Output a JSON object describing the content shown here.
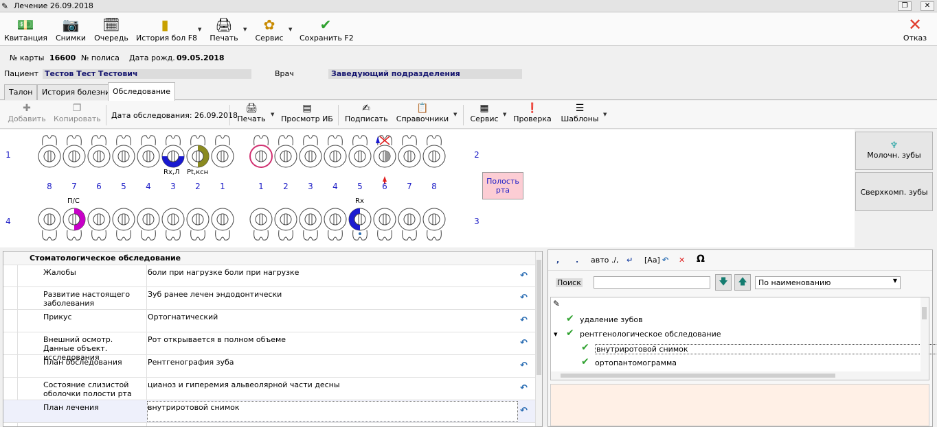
{
  "window": {
    "title": "Лечение 26.09.2018"
  },
  "toolbar": {
    "kvit": "Квитанция",
    "snimki": "Снимки",
    "ochered": "Очередь",
    "history": "История бол F8",
    "print": "Печать",
    "service": "Сервис",
    "save": "Сохранить F2",
    "cancel": "Отказ"
  },
  "info": {
    "card_label": "№ карты",
    "card_value": "16600",
    "policy_label": "№ полиса",
    "birth_label": "Дата рожд.",
    "birth_value": "09.05.2018"
  },
  "patient": {
    "label": "Пациент",
    "name": "Тестов Тест Тестович",
    "doctor_label": "Врач",
    "doctor": "Заведующий подразделения"
  },
  "tabs": [
    "Талон",
    "История болезни",
    "Обследование"
  ],
  "toolbar2": {
    "add": "Добавить",
    "copy": "Копировать",
    "date": "Дата обследования: 26.09.2018",
    "print": "Печать",
    "view": "Просмотр ИБ",
    "sign": "Подписать",
    "refs": "Справочники",
    "service": "Сервис",
    "check": "Проверка",
    "templates": "Шаблоны"
  },
  "chart": {
    "quadrants": {
      "q1": "1",
      "q2": "2",
      "q3": "3",
      "q4": "4"
    },
    "upper_labels": [
      "Rx,Л",
      "Pt,ксн"
    ],
    "lower_labels": [
      "П/С",
      "Rx"
    ],
    "left_numbers": [
      "8",
      "7",
      "6",
      "5",
      "4",
      "3",
      "2",
      "1"
    ],
    "right_numbers": [
      "1",
      "2",
      "3",
      "4",
      "5",
      "6",
      "7",
      "8"
    ],
    "polost": "Полость рта"
  },
  "side": {
    "milk": "Молочн. зубы",
    "extra": "Сверхкомп. зубы"
  },
  "grid": {
    "section": "Стоматологическое обследование",
    "rows": [
      {
        "caption": "Жалобы",
        "value": "боли при нагрузке боли при нагрузке"
      },
      {
        "caption": "Развитие настоящего заболевания",
        "value": "Зуб ранее лечен эндодонтически"
      },
      {
        "caption": "Прикус",
        "value": "Ортогнатический"
      },
      {
        "caption": "Внешний осмотр. Данные объект. исследования",
        "value": "Рот открывается в полном объеме"
      },
      {
        "caption": "План обследования",
        "value": "Рентгенография зуба"
      },
      {
        "caption": "Состояние слизистой оболочки полости рта",
        "value": "цианоз и гиперемия альвеолярной части десны"
      },
      {
        "caption": "План лечения",
        "value": "внутриротовой снимок"
      }
    ]
  },
  "right": {
    "comma": ",",
    "dot": ".",
    "auto": "авто ./,",
    "aa": "[Аа]",
    "omega": "Ω",
    "search_label": "Поиск",
    "sort": "По наименованию",
    "tree": [
      {
        "label": "удаление зубов",
        "level": 0
      },
      {
        "label": "рентгенологическое обследование",
        "level": 0
      },
      {
        "label": "внутриротовой снимок",
        "level": 1
      },
      {
        "label": "ортопантомограмма",
        "level": 1
      }
    ]
  },
  "colors": {
    "navy": "#14146e",
    "blue_num": "#1c1cc6",
    "check": "#2ea12e",
    "pink": "#fccdd4"
  }
}
